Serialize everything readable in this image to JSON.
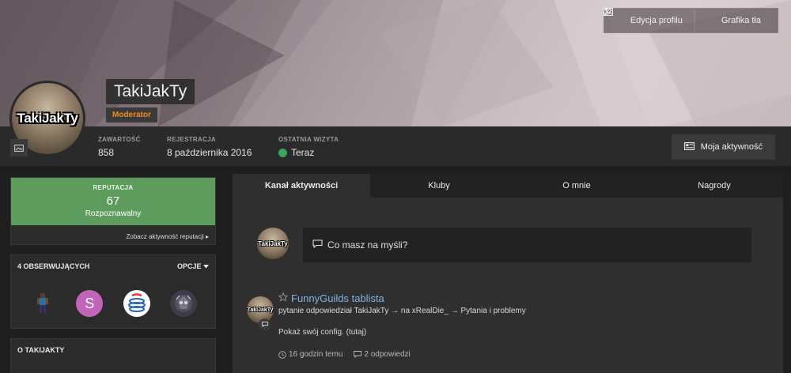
{
  "cover": {
    "edit_profile_label": "Edycja profilu",
    "cover_photo_label": "Grafika tła",
    "icons": {
      "edit": "pencil-icon",
      "cover": "image-icon",
      "caret": "caret-down-icon"
    }
  },
  "profile": {
    "avatar_text": "TakiJakTy",
    "username": "TakiJakTy",
    "rank": "Moderator",
    "stats": [
      {
        "label": "ZAWARTOŚĆ",
        "value": "858"
      },
      {
        "label": "REJESTRACJA",
        "value": "8 października 2016"
      },
      {
        "label": "OSTATNIA WIZYTA",
        "value": "Teraz"
      }
    ],
    "my_activity_label": "Moja aktywność"
  },
  "sidebar": {
    "reputation": {
      "label": "REPUTACJA",
      "value": "67",
      "level": "Rozpoznawalny",
      "link": "Zobacz aktywność reputacji"
    },
    "followers": {
      "title": "4 OBSERWUJĄCYCH",
      "options_label": "OPCJE",
      "items": [
        {
          "name": "follower-1",
          "letter": ""
        },
        {
          "name": "follower-2",
          "letter": "S"
        },
        {
          "name": "follower-3",
          "letter": ""
        },
        {
          "name": "follower-4",
          "letter": ""
        }
      ]
    },
    "about_title": "O TAKIJAKTY"
  },
  "main": {
    "tabs": [
      "Kanał aktywności",
      "Kluby",
      "O mnie",
      "Nagrody"
    ],
    "active_tab": 0,
    "composer_placeholder": "Co masz na myśli?",
    "post": {
      "title": "FunnyGuilds tablista",
      "subtitle": "pytanie odpowiedział TakiJakTy → na xRealDie_ → Pytania i problemy",
      "body": "Pokaż swój config. (tutaj)",
      "time": "16 godzin temu",
      "replies": "2 odpowiedzi"
    }
  },
  "colors": {
    "accent_rank": "#f08c1e",
    "reputation_bg": "#5d9c5c",
    "link": "#7fb3e6",
    "online": "#3ea35b"
  }
}
